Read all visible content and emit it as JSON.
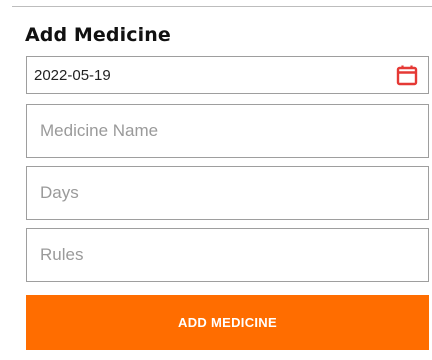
{
  "form": {
    "title": "Add Medicine",
    "date_value": "2022-05-19",
    "medicine_name_placeholder": "Medicine Name",
    "days_placeholder": "Days",
    "rules_placeholder": "Rules",
    "submit_label": "ADD MEDICINE"
  },
  "icons": {
    "calendar": "calendar-icon"
  },
  "colors": {
    "accent": "#ff6d00",
    "calendar_icon": "#e53935",
    "border": "#9e9e9e",
    "placeholder": "#9a9a9a"
  }
}
